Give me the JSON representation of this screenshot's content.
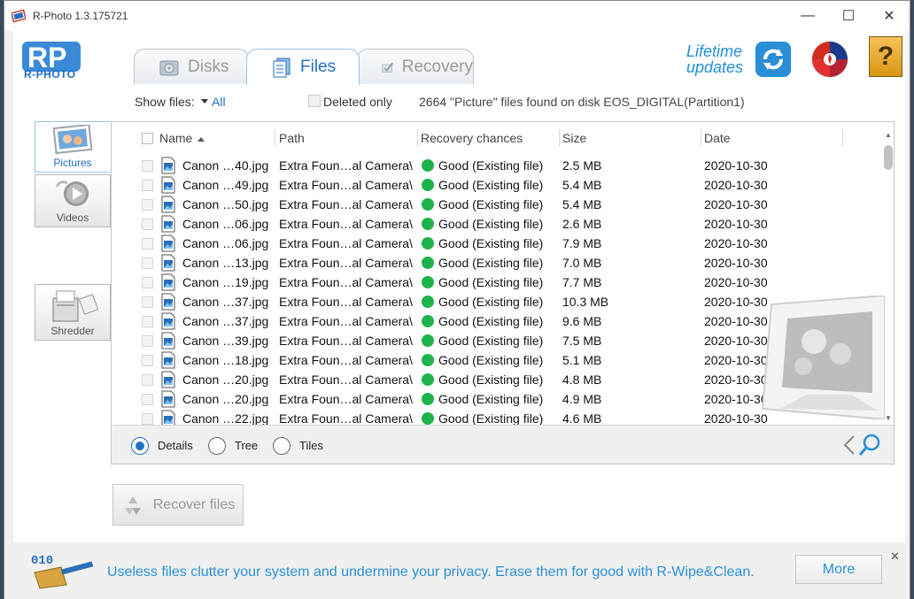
{
  "window": {
    "title": "R-Photo 1.3.175721",
    "minimize": "—",
    "maximize": "☐",
    "close": "✕"
  },
  "logo": {
    "text": "R-PHOTO",
    "letters": "RP"
  },
  "tabs": [
    {
      "label": "Disks",
      "active": false
    },
    {
      "label": "Files",
      "active": true
    },
    {
      "label": "Recovery",
      "active": false
    }
  ],
  "updates": {
    "line1": "Lifetime",
    "line2": "updates"
  },
  "help": {
    "label": "?"
  },
  "filter": {
    "show_label": "Show files:",
    "show_value": "All",
    "deleted_only_label": "Deleted only",
    "status": "2664 \"Picture\" files found on disk EOS_DIGITAL(Partition1)"
  },
  "sidenav": [
    {
      "label": "Pictures",
      "active": true
    },
    {
      "label": "Videos",
      "active": false
    },
    {
      "label": "Shredder",
      "active": false
    }
  ],
  "table": {
    "columns": [
      "Name",
      "Path",
      "Recovery chances",
      "Size",
      "Date"
    ],
    "rows": [
      {
        "name": "Canon …40.jpg",
        "path": "Extra Foun…al Camera\\",
        "chance": "Good (Existing file)",
        "size": "2.5 MB",
        "date": "2020-10-30"
      },
      {
        "name": "Canon …49.jpg",
        "path": "Extra Foun…al Camera\\",
        "chance": "Good (Existing file)",
        "size": "5.4 MB",
        "date": "2020-10-30"
      },
      {
        "name": "Canon …50.jpg",
        "path": "Extra Foun…al Camera\\",
        "chance": "Good (Existing file)",
        "size": "5.4 MB",
        "date": "2020-10-30"
      },
      {
        "name": "Canon …06.jpg",
        "path": "Extra Foun…al Camera\\",
        "chance": "Good (Existing file)",
        "size": "2.6 MB",
        "date": "2020-10-30"
      },
      {
        "name": "Canon …06.jpg",
        "path": "Extra Foun…al Camera\\",
        "chance": "Good (Existing file)",
        "size": "7.9 MB",
        "date": "2020-10-30"
      },
      {
        "name": "Canon …13.jpg",
        "path": "Extra Foun…al Camera\\",
        "chance": "Good (Existing file)",
        "size": "7.0 MB",
        "date": "2020-10-30"
      },
      {
        "name": "Canon …19.jpg",
        "path": "Extra Foun…al Camera\\",
        "chance": "Good (Existing file)",
        "size": "7.7 MB",
        "date": "2020-10-30"
      },
      {
        "name": "Canon …37.jpg",
        "path": "Extra Foun…al Camera\\",
        "chance": "Good (Existing file)",
        "size": "10.3 MB",
        "date": "2020-10-30"
      },
      {
        "name": "Canon …37.jpg",
        "path": "Extra Foun…al Camera\\",
        "chance": "Good (Existing file)",
        "size": "9.6 MB",
        "date": "2020-10-30"
      },
      {
        "name": "Canon …39.jpg",
        "path": "Extra Foun…al Camera\\",
        "chance": "Good (Existing file)",
        "size": "7.5 MB",
        "date": "2020-10-30"
      },
      {
        "name": "Canon …18.jpg",
        "path": "Extra Foun…al Camera\\",
        "chance": "Good (Existing file)",
        "size": "5.1 MB",
        "date": "2020-10-30"
      },
      {
        "name": "Canon …20.jpg",
        "path": "Extra Foun…al Camera\\",
        "chance": "Good (Existing file)",
        "size": "4.8 MB",
        "date": "2020-10-30"
      },
      {
        "name": "Canon …20.jpg",
        "path": "Extra Foun…al Camera\\",
        "chance": "Good (Existing file)",
        "size": "4.9 MB",
        "date": "2020-10-30"
      },
      {
        "name": "Canon …22.jpg",
        "path": "Extra Foun…al Camera\\",
        "chance": "Good (Existing file)",
        "size": "4.6 MB",
        "date": "2020-10-30"
      }
    ]
  },
  "views": [
    {
      "label": "Details",
      "selected": true
    },
    {
      "label": "Tree",
      "selected": false
    },
    {
      "label": "Tiles",
      "selected": false
    }
  ],
  "recover_button": "Recover files",
  "ad": {
    "text": "Useless files clutter your system and undermine your privacy. Erase them for good with R-Wipe&Clean.",
    "more": "More",
    "close": "✕"
  },
  "colors": {
    "accent": "#1f6fc5",
    "good_status": "#1fb34b",
    "ad_text": "#2a8fd6"
  }
}
